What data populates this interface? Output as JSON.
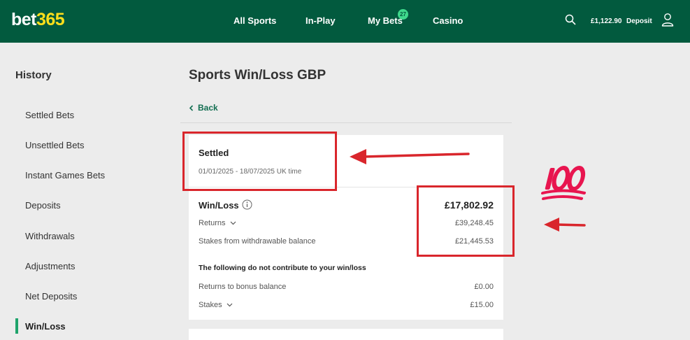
{
  "header": {
    "logo_part1": "bet",
    "logo_part2": "365",
    "nav": [
      "All Sports",
      "In-Play",
      "My Bets",
      "Casino"
    ],
    "my_bets_count": "27",
    "balance": "£1,122.90",
    "deposit_label": "Deposit",
    "brand_color": "#025a3e",
    "logo_accent": "#ffdf1b",
    "icons": [
      "search-icon",
      "user-icon"
    ]
  },
  "sidebar": {
    "title": "History",
    "items": [
      "Settled Bets",
      "Unsettled Bets",
      "Instant Games Bets",
      "Deposits",
      "Withdrawals",
      "Adjustments",
      "Net Deposits",
      "Win/Loss"
    ],
    "active": "Win/Loss"
  },
  "main": {
    "title": "Sports Win/Loss GBP",
    "back_label": "Back",
    "card": {
      "heading": "Settled",
      "date_range": "01/01/2025 - 18/07/2025 UK time",
      "winloss_label": "Win/Loss",
      "winloss_value": "£17,802.92",
      "returns_label": "Returns",
      "returns_value": "£39,248.45",
      "stakes_label": "Stakes from withdrawable balance",
      "stakes_value": "£21,445.53",
      "note": "The following do not contribute to your win/loss",
      "bonus_label": "Returns to bonus balance",
      "bonus_value": "£0.00",
      "stakes2_label": "Stakes",
      "stakes2_value": "£15.00"
    }
  },
  "annotations": {
    "emoji": "💯",
    "color": "#d9262c"
  }
}
